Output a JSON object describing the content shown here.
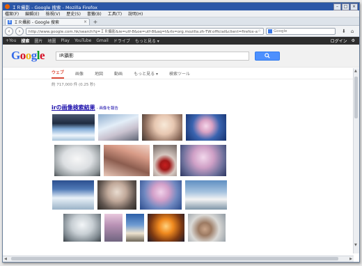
{
  "window": {
    "title": "ＩＲ攝影 - Google 搜索 - Mozilla Firefox"
  },
  "menu": [
    "檔案(F)",
    "編輯(E)",
    "檢視(V)",
    "歷史(S)",
    "書籤(B)",
    "工具(T)",
    "說明(H)"
  ],
  "tab": {
    "label": "ＩＲ攝影 - Google 搜索"
  },
  "nav": {
    "url_domain": "google.com.hk",
    "url": "http://www.google.com.hk/search?q=ＩＲ攝影&ie=utf-8&oe=utf-8&aq=t&rls=org.mozilla:zh-TW:official&client=firefox-a",
    "search_placeholder": "Google"
  },
  "gbar": {
    "items": [
      "+You",
      "搜索",
      "圖片",
      "地圖",
      "Play",
      "YouTube",
      "Gmail",
      "ドライブ",
      "もっと見る ▾"
    ],
    "login": "ログイン"
  },
  "google": {
    "query": "IR攝影"
  },
  "tabs": [
    "ウェブ",
    "画像",
    "地図",
    "動画",
    "もっと見る ▾",
    "検索ツール"
  ],
  "stats": "約 717,000 件 (0.25 秒)",
  "result": {
    "title_prefix": "ir",
    "title_rest": "の画像検索結果",
    "report": "- 画像を報告"
  }
}
